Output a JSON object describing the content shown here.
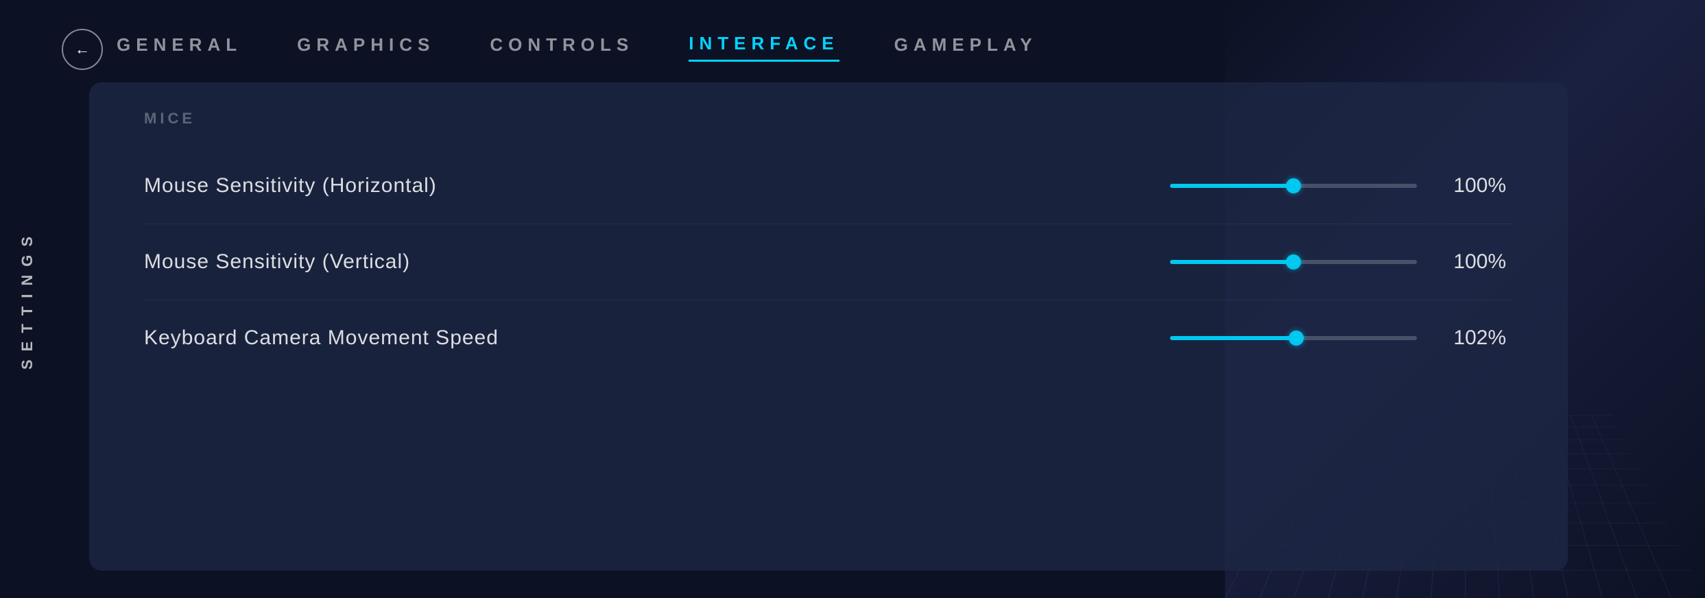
{
  "sidebar": {
    "label": "SETTINGS"
  },
  "back_button": {
    "aria_label": "Go Back",
    "arrow": "←"
  },
  "nav": {
    "items": [
      {
        "id": "general",
        "label": "GENERAL",
        "active": false
      },
      {
        "id": "graphics",
        "label": "GRAPHICS",
        "active": false
      },
      {
        "id": "controls",
        "label": "CONTROLS",
        "active": false
      },
      {
        "id": "interface",
        "label": "INTERFACE",
        "active": true
      },
      {
        "id": "gameplay",
        "label": "GAMEPLAY",
        "active": false
      }
    ]
  },
  "section": {
    "title": "MICE",
    "settings": [
      {
        "id": "mouse-sensitivity-horizontal",
        "label": "Mouse Sensitivity (Horizontal)",
        "value": 100,
        "value_display": "100%",
        "min": 0,
        "max": 200,
        "fill_percent": 50
      },
      {
        "id": "mouse-sensitivity-vertical",
        "label": "Mouse Sensitivity (Vertical)",
        "value": 100,
        "value_display": "100%",
        "min": 0,
        "max": 200,
        "fill_percent": 50
      },
      {
        "id": "keyboard-camera-speed",
        "label": "Keyboard Camera Movement Speed",
        "value": 102,
        "value_display": "102%",
        "min": 0,
        "max": 200,
        "fill_percent": 51
      }
    ]
  },
  "colors": {
    "accent": "#00c8f0",
    "bg_dark": "#0d1124",
    "panel_bg": "rgba(30,40,70,0.75)"
  }
}
